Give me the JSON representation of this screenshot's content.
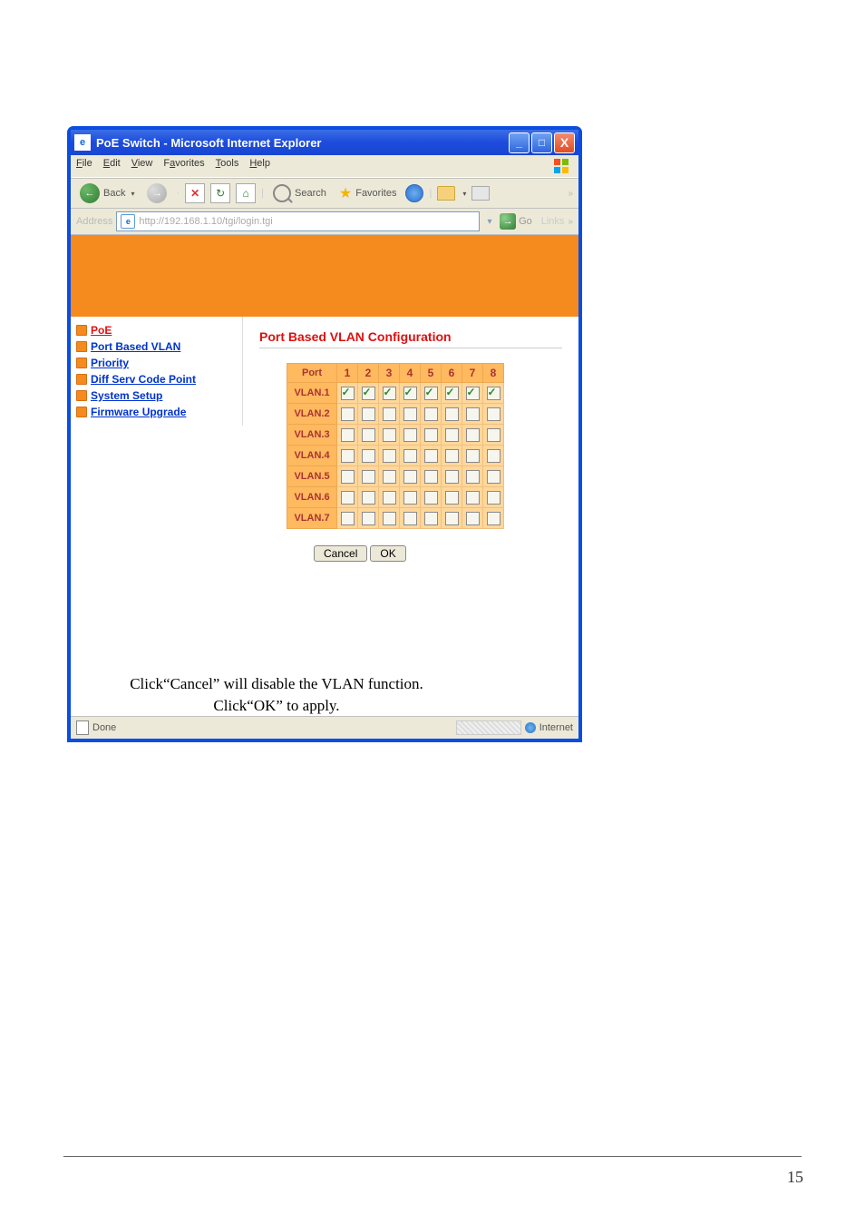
{
  "window": {
    "title": "PoE Switch - Microsoft Internet Explorer",
    "minimize": "_",
    "maximize": "□",
    "close": "X"
  },
  "menu": {
    "file": "File",
    "edit": "Edit",
    "view": "View",
    "favorites": "Favorites",
    "tools": "Tools",
    "help": "Help"
  },
  "toolbar": {
    "back": "Back",
    "search": "Search",
    "favorites": "Favorites"
  },
  "address": {
    "label": "Address",
    "url": "http://192.168.1.10/tgi/login.tgi",
    "go": "Go",
    "links": "Links"
  },
  "sidebar": {
    "items": [
      {
        "label": "PoE",
        "current": true
      },
      {
        "label": "Port Based VLAN",
        "current": false
      },
      {
        "label": "Priority",
        "current": false
      },
      {
        "label": "Diff Serv Code Point",
        "current": false
      },
      {
        "label": "System Setup",
        "current": false
      },
      {
        "label": "Firmware Upgrade",
        "current": false
      }
    ]
  },
  "main": {
    "heading": "Port Based VLAN Configuration",
    "port_header": "Port",
    "ports": [
      "1",
      "2",
      "3",
      "4",
      "5",
      "6",
      "7",
      "8"
    ],
    "rows": [
      {
        "label": "VLAN.1",
        "cells": [
          true,
          true,
          true,
          true,
          true,
          true,
          true,
          true
        ]
      },
      {
        "label": "VLAN.2",
        "cells": [
          false,
          false,
          false,
          false,
          false,
          false,
          false,
          false
        ]
      },
      {
        "label": "VLAN.3",
        "cells": [
          false,
          false,
          false,
          false,
          false,
          false,
          false,
          false
        ]
      },
      {
        "label": "VLAN.4",
        "cells": [
          false,
          false,
          false,
          false,
          false,
          false,
          false,
          false
        ]
      },
      {
        "label": "VLAN.5",
        "cells": [
          false,
          false,
          false,
          false,
          false,
          false,
          false,
          false
        ]
      },
      {
        "label": "VLAN.6",
        "cells": [
          false,
          false,
          false,
          false,
          false,
          false,
          false,
          false
        ]
      },
      {
        "label": "VLAN.7",
        "cells": [
          false,
          false,
          false,
          false,
          false,
          false,
          false,
          false
        ]
      }
    ],
    "cancel": "Cancel",
    "ok": "OK"
  },
  "status": {
    "left": "Done",
    "right": "Internet"
  },
  "caption": {
    "line1a": "Click",
    "line1b": "Cancel",
    "line1c": " will disable the VLAN function.",
    "line2a": "Click",
    "line2b": "OK",
    "line2c": " to apply."
  },
  "page_number": "15"
}
